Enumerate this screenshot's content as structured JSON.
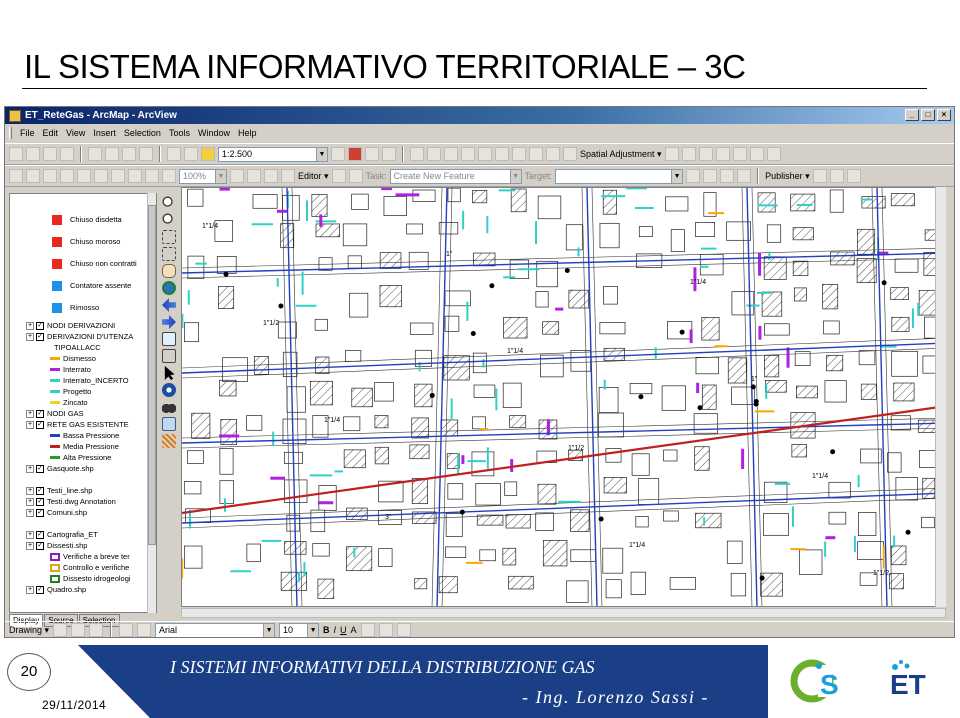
{
  "slide": {
    "title": "IL SISTEMA INFORMATIVO TERRITORIALE – 3C",
    "page_number": "20",
    "date": "29/11/2014",
    "footer_line1": "I SISTEMI INFORMATIVI DELLA DISTRIBUZIONE GAS",
    "footer_line2": "- Ing. Lorenzo Sassi -",
    "logos": [
      "CIS",
      "ET"
    ]
  },
  "window": {
    "title": "ET_ReteGas - ArcMap - ArcView",
    "controls": [
      "_",
      "□",
      "×"
    ]
  },
  "menu": [
    "File",
    "Edit",
    "View",
    "Insert",
    "Selection",
    "Tools",
    "Window",
    "Help"
  ],
  "toolbar": {
    "scale": "1:2.500",
    "zoom": "100%",
    "editor_label": "Editor ▾",
    "task_label": "Task:",
    "task_value": "Create New Feature",
    "target_label": "Target:",
    "spatial_adjustment": "Spatial Adjustment ▾",
    "publisher": "Publisher ▾"
  },
  "toc": {
    "items": [
      {
        "label": "Chiuso disdetta",
        "type": "symbol",
        "color": "#e8281e"
      },
      {
        "label": "Chiuso moroso",
        "type": "symbol",
        "color": "#e8281e"
      },
      {
        "label": "Chiuso non contratti",
        "type": "symbol",
        "color": "#e8281e"
      },
      {
        "label": "Contatore assente",
        "type": "symbol",
        "color": "#1e90e8"
      },
      {
        "label": "Rimosso",
        "type": "symbol",
        "color": "#1e90e8"
      },
      {
        "label": "NODI DERIVAZIONI",
        "type": "layer"
      },
      {
        "label": "DERIVAZIONI D'UTENZA",
        "type": "layer"
      },
      {
        "label": "TIPOALLACC",
        "type": "field"
      },
      {
        "label": "Dismesso",
        "type": "line",
        "color": "#ffa500"
      },
      {
        "label": "Interrato",
        "type": "line",
        "color": "#b020e0"
      },
      {
        "label": "Interrato_INCERTO",
        "type": "line",
        "color": "#30d0c8"
      },
      {
        "label": "Progetto",
        "type": "line",
        "color": "#30d0c8"
      },
      {
        "label": "Zincato",
        "type": "line",
        "color": "#e8d820"
      },
      {
        "label": "NODI GAS",
        "type": "layer"
      },
      {
        "label": "RETE GAS ESISTENTE",
        "type": "layer"
      },
      {
        "label": "Bassa Pressione",
        "type": "line",
        "color": "#2040c0"
      },
      {
        "label": "Media Pressione",
        "type": "line",
        "color": "#c02020"
      },
      {
        "label": "Alta Pressione",
        "type": "line",
        "color": "#20a020"
      },
      {
        "label": "Gasquote.shp",
        "type": "layer"
      },
      {
        "label": "Testi_line.shp",
        "type": "layer"
      },
      {
        "label": "Testi.dwg Annotation",
        "type": "layer"
      },
      {
        "label": "Comuni.shp",
        "type": "layer"
      },
      {
        "label": "Cartografia_ET",
        "type": "layer"
      },
      {
        "label": "Dissesti.shp",
        "type": "layer"
      },
      {
        "label": "Verifiche a breve ter",
        "type": "box",
        "color": "#8020c0"
      },
      {
        "label": "Controllo e verifiche",
        "type": "box",
        "color": "#e0a020"
      },
      {
        "label": "Dissesto idrogeologi",
        "type": "box",
        "color": "#208020"
      },
      {
        "label": "Quadro.shp",
        "type": "layer"
      }
    ],
    "tabs": [
      "Display",
      "Source",
      "Selection"
    ]
  },
  "map": {
    "labels": [
      "1\"1/4",
      "1\"1/2",
      "1\"1/4",
      "3\"",
      "1\"",
      "1\"1/4",
      "1\"1/2",
      "1\"1/4",
      "1\"1/4",
      "1\"",
      "1\"1/4",
      "1\"1/2"
    ]
  },
  "drawing": {
    "label": "Drawing ▾",
    "font": "Arial",
    "size": "10",
    "styles": [
      "B",
      "I",
      "U",
      "A"
    ]
  },
  "colors": {
    "footer_band": "#1b3f86",
    "low_pressure": "#2040c0",
    "medium_pressure": "#c02020",
    "service_line": "#30d0c8",
    "interrato": "#b020e0",
    "dismesso": "#ffa500"
  }
}
